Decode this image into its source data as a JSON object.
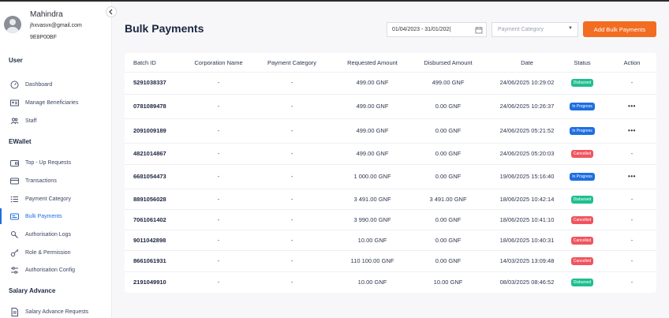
{
  "profile": {
    "name": "Mahindra",
    "email": "jhxvasvx@gmail.com",
    "code": "9E8P00BF"
  },
  "sidebar": {
    "sections": [
      {
        "title": "User",
        "items": [
          {
            "label": "Dashboard",
            "icon": "dashboard-icon",
            "active": false
          },
          {
            "label": "Manage Beneficiaries",
            "icon": "id-card-icon",
            "active": false
          },
          {
            "label": "Staff",
            "icon": "users-icon",
            "active": false
          }
        ]
      },
      {
        "title": "EWallet",
        "items": [
          {
            "label": "Top - Up Requests",
            "icon": "wallet-icon",
            "active": false
          },
          {
            "label": "Transactions",
            "icon": "transactions-icon",
            "active": false
          },
          {
            "label": "Payment Category",
            "icon": "list-icon",
            "active": false
          },
          {
            "label": "Bulk Payments",
            "icon": "bulk-payments-icon",
            "active": true
          },
          {
            "label": "Authorisation Logs",
            "icon": "logs-icon",
            "active": false
          },
          {
            "label": "Role & Permission",
            "icon": "key-icon",
            "active": false
          },
          {
            "label": "Authorisation Config",
            "icon": "config-icon",
            "active": false
          }
        ]
      },
      {
        "title": "Salary Advance",
        "items": [
          {
            "label": "Salary Advance Requests",
            "icon": "document-icon",
            "active": false
          }
        ]
      }
    ]
  },
  "header": {
    "title": "Bulk Payments",
    "date_range": "01/04/2023 - 31/01/202(",
    "category_placeholder": "Payment Category",
    "add_button": "Add Bulk Payments"
  },
  "colors": {
    "accent": "#f26c22",
    "active": "#1e6ee0",
    "disbursed": "#1fbf8f",
    "in_progress": "#1e6ee0",
    "cancelled": "#f0555f"
  },
  "table": {
    "columns": [
      "Batch ID",
      "Corporation Name",
      "Payment Category",
      "Requested Amount",
      "Disbursed Amount",
      "Date",
      "Status",
      "Action"
    ],
    "rows": [
      {
        "batch_id": "5291038337",
        "corporation": "-",
        "category": "-",
        "requested": "499.00 GNF",
        "disbursed": "499.00 GNF",
        "date": "24/06/2025 10:29:02",
        "status": "Disbursed",
        "status_key": "disbursed",
        "action": "-"
      },
      {
        "batch_id": "0781089478",
        "corporation": "-",
        "category": "-",
        "requested": "499.00 GNF",
        "disbursed": "0.00 GNF",
        "date": "24/06/2025 10:26:37",
        "status": "In Progress",
        "status_key": "in_progress",
        "action": "•••"
      },
      {
        "batch_id": "2091009189",
        "corporation": "-",
        "category": "-",
        "requested": "499.00 GNF",
        "disbursed": "0.00 GNF",
        "date": "24/06/2025 05:21:52",
        "status": "In Progress",
        "status_key": "in_progress",
        "action": "•••"
      },
      {
        "batch_id": "4821014867",
        "corporation": "-",
        "category": "-",
        "requested": "499.00 GNF",
        "disbursed": "0.00 GNF",
        "date": "24/06/2025 05:20:03",
        "status": "Cancelled",
        "status_key": "cancelled",
        "action": "-"
      },
      {
        "batch_id": "6681054473",
        "corporation": "-",
        "category": "-",
        "requested": "1 000.00 GNF",
        "disbursed": "0.00 GNF",
        "date": "19/06/2025 15:16:40",
        "status": "In Progress",
        "status_key": "in_progress",
        "action": "•••"
      },
      {
        "batch_id": "8891056028",
        "corporation": "-",
        "category": "-",
        "requested": "3 491.00 GNF",
        "disbursed": "3 491.00 GNF",
        "date": "18/06/2025 10:42:14",
        "status": "Disbursed",
        "status_key": "disbursed",
        "action": "-"
      },
      {
        "batch_id": "7061061402",
        "corporation": "-",
        "category": "-",
        "requested": "3 990.00 GNF",
        "disbursed": "0.00 GNF",
        "date": "18/06/2025 10:41:10",
        "status": "Cancelled",
        "status_key": "cancelled",
        "action": "-"
      },
      {
        "batch_id": "9011042898",
        "corporation": "-",
        "category": "-",
        "requested": "10.00 GNF",
        "disbursed": "0.00 GNF",
        "date": "18/06/2025 10:40:31",
        "status": "Cancelled",
        "status_key": "cancelled",
        "action": "-"
      },
      {
        "batch_id": "8661061931",
        "corporation": "-",
        "category": "-",
        "requested": "110 100.00 GNF",
        "disbursed": "0.00 GNF",
        "date": "14/03/2025 13:09:48",
        "status": "Cancelled",
        "status_key": "cancelled",
        "action": "-"
      },
      {
        "batch_id": "2191049910",
        "corporation": "-",
        "category": "-",
        "requested": "10.00 GNF",
        "disbursed": "10.00 GNF",
        "date": "08/03/2025 08:46:52",
        "status": "Disbursed",
        "status_key": "disbursed",
        "action": "-"
      }
    ]
  }
}
